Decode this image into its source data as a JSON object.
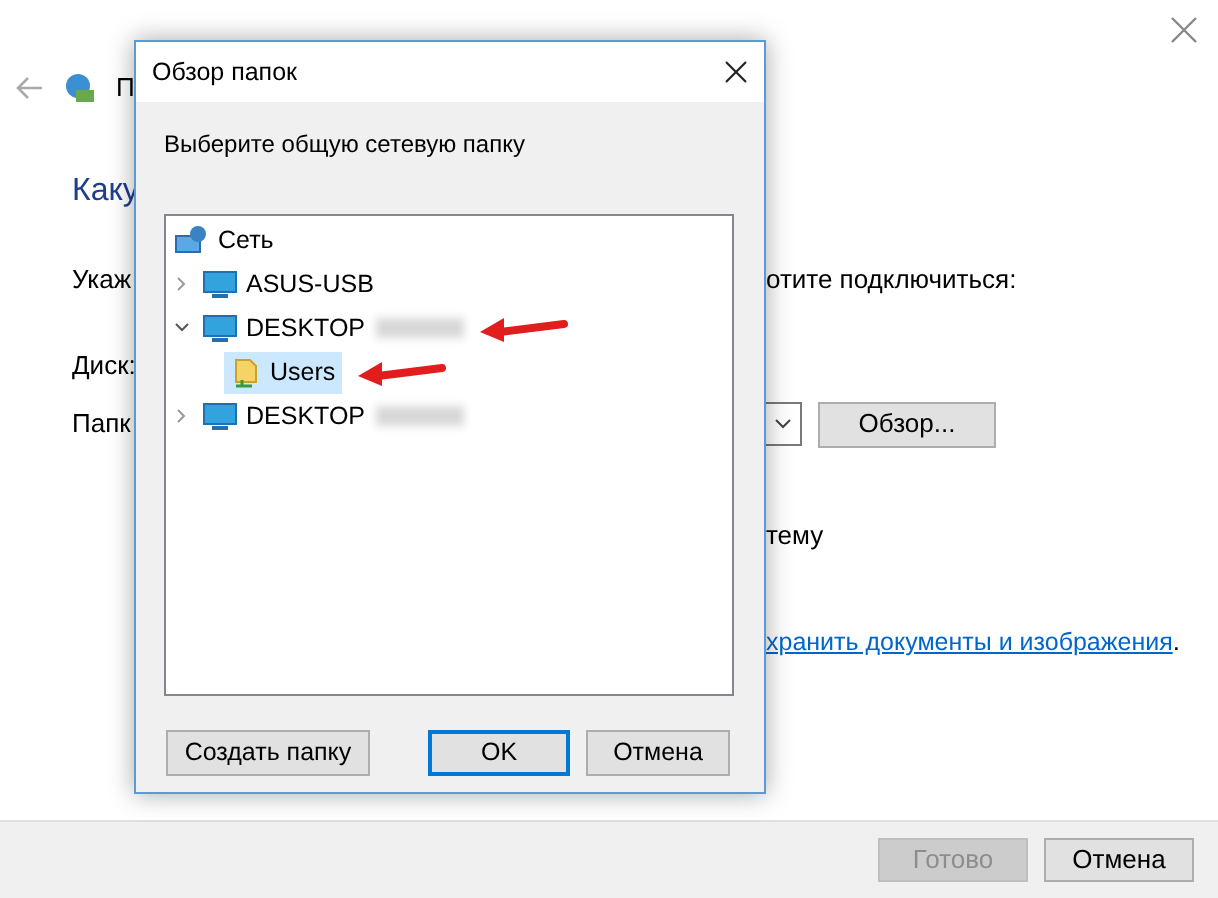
{
  "window": {
    "title": "П",
    "heading": "Каку",
    "instruction_left": "Укаж",
    "instruction_right": "отите подключиться:",
    "drive_label": "Диск:",
    "folder_label": "Папк",
    "browse_button": "Обзор...",
    "line_right": "тему",
    "link": "хранить документы и изображения",
    "link_tail": ".",
    "buttons": [
      {
        "label": "Готово",
        "disabled": true
      },
      {
        "label": "Отмена",
        "disabled": false
      }
    ]
  },
  "dialog": {
    "title": "Обзор папок",
    "prompt": "Выберите общую сетевую папку",
    "tree": [
      {
        "label": "Сеть",
        "kind": "network",
        "selected": false,
        "children": [
          {
            "label": "ASUS-USB",
            "kind": "computer",
            "expanded": false,
            "selected": false,
            "redacted": false,
            "arrow": false
          },
          {
            "label": "DESKTOP",
            "kind": "computer",
            "expanded": true,
            "selected": false,
            "redacted": true,
            "arrow": true,
            "children": [
              {
                "label": "Users",
                "kind": "folder",
                "selected": true,
                "arrow": true
              }
            ]
          },
          {
            "label": "DESKTOP",
            "kind": "computer",
            "expanded": false,
            "selected": false,
            "redacted": true,
            "arrow": false
          }
        ]
      }
    ],
    "buttons": [
      {
        "label": "Создать папку",
        "default": false
      },
      {
        "label": "OK",
        "default": true
      },
      {
        "label": "Отмена",
        "default": false
      }
    ]
  }
}
